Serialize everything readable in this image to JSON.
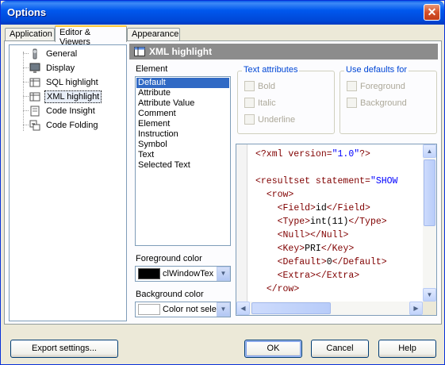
{
  "window": {
    "title": "Options",
    "close_symbol": "✕"
  },
  "tabs": [
    {
      "label": "Application"
    },
    {
      "label": "Editor & Viewers"
    },
    {
      "label": "Appearance"
    }
  ],
  "tree": {
    "items": [
      {
        "label": "General",
        "icon": "wrench-icon"
      },
      {
        "label": "Display",
        "icon": "monitor-icon"
      },
      {
        "label": "SQL highlight",
        "icon": "grid-icon"
      },
      {
        "label": "XML highlight",
        "icon": "grid-icon"
      },
      {
        "label": "Code Insight",
        "icon": "document-icon"
      },
      {
        "label": "Code Folding",
        "icon": "folding-icon"
      }
    ]
  },
  "panel": {
    "header": "XML highlight",
    "element_label": "Element",
    "elements": [
      "Default",
      "Attribute",
      "Attribute Value",
      "Comment",
      "Element",
      "Instruction",
      "Symbol",
      "Text",
      "Selected Text"
    ],
    "selected_element": "Default",
    "text_attributes": {
      "title": "Text attributes",
      "bold": "Bold",
      "italic": "Italic",
      "underline": "Underline"
    },
    "use_defaults": {
      "title": "Use defaults for",
      "foreground": "Foreground",
      "background": "Background"
    },
    "foreground": {
      "label": "Foreground color",
      "value": "clWindowTex",
      "swatch": "#000000"
    },
    "background": {
      "label": "Background color",
      "value": "Color not sele",
      "swatch": "#FFFFFF"
    }
  },
  "preview": {
    "lines": [
      "<?xml version=\"1.0\"?>",
      "",
      "<resultset statement=\"SHOW",
      "  <row>",
      "    <Field>id</Field>",
      "    <Type>int(11)</Type>",
      "    <Null></Null>",
      "    <Key>PRI</Key>",
      "    <Default>0</Default>",
      "    <Extra></Extra>",
      "  </row>"
    ]
  },
  "buttons": {
    "export": "Export settings...",
    "ok": "OK",
    "cancel": "Cancel",
    "help": "Help"
  },
  "colors": {
    "title_bar": "#0058EE",
    "header_bar": "#8C8C8C",
    "selection": "#316AC5",
    "xml_tag": "#800000",
    "xml_string": "#0000FF"
  }
}
